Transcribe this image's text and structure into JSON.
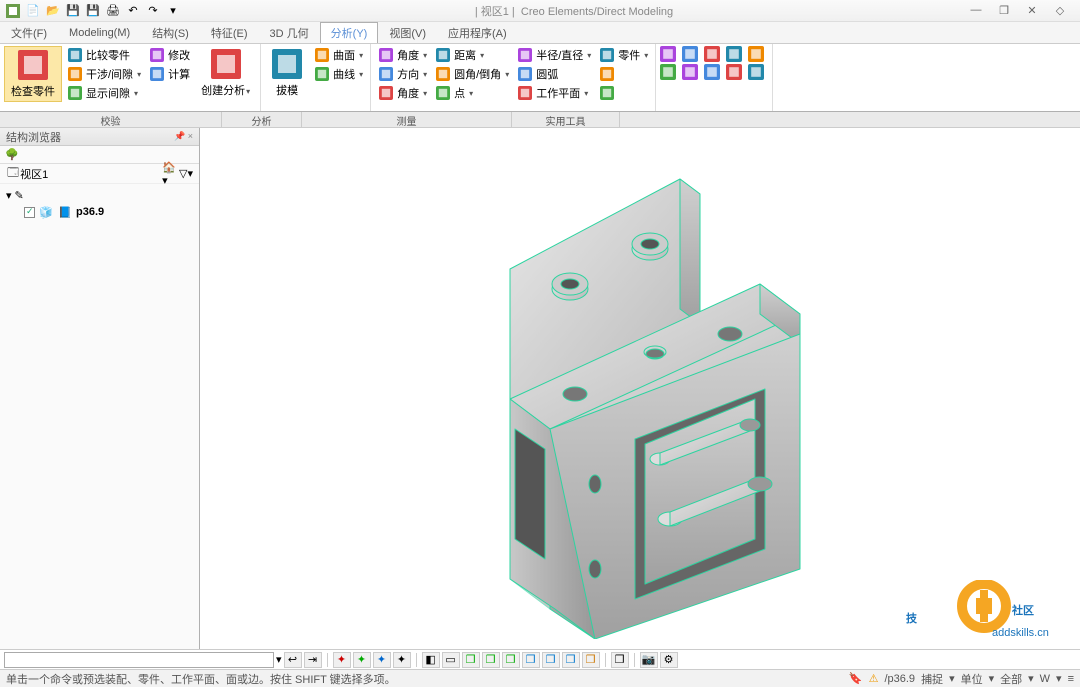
{
  "title_doc": "| 视区1 |",
  "title_app": "Creo Elements/Direct Modeling",
  "wctrl": {
    "min": "—",
    "max": "❐",
    "close": "✕",
    "help": "◇"
  },
  "tabs": [
    "文件(F)",
    "Modeling(M)",
    "结构(S)",
    "特征(E)",
    "3D 几何",
    "分析(Y)",
    "视图(V)",
    "应用程序(A)"
  ],
  "active_tab": 5,
  "ribbon": {
    "groups": [
      {
        "label": "校验",
        "big": [
          {
            "name": "检查零件",
            "active": true
          }
        ],
        "cols": [
          [
            {
              "l": "比较零件"
            },
            {
              "l": "干涉/间隙",
              "d": true
            },
            {
              "l": "显示间隙",
              "d": true
            }
          ],
          [
            {
              "l": "修改"
            },
            {
              "l": "计算"
            }
          ]
        ],
        "big2": [
          {
            "name": "创建分析",
            "d": true
          }
        ]
      },
      {
        "label": "分析",
        "big": [
          {
            "name": "拔模",
            "d": true
          }
        ],
        "cols": [
          [
            {
              "l": "曲面",
              "d": true
            },
            {
              "l": "曲线",
              "d": true
            }
          ]
        ]
      },
      {
        "label": "测量",
        "cols": [
          [
            {
              "l": "角度",
              "d": true
            },
            {
              "l": "方向",
              "d": true
            },
            {
              "l": "角度",
              "d": true
            }
          ],
          [
            {
              "l": "距离",
              "d": true
            },
            {
              "l": "圆角/倒角",
              "d": true
            },
            {
              "l": "点",
              "d": true
            }
          ],
          [
            {
              "l": "半径/直径",
              "d": true
            },
            {
              "l": "圆弧"
            },
            {
              "l": "工作平面",
              "d": true
            }
          ],
          [
            {
              "l": "零件",
              "d": true
            },
            {
              "l": ""
            },
            {
              "l": ""
            }
          ]
        ]
      },
      {
        "label": "实用工具",
        "grid": true
      }
    ]
  },
  "group_widths": [
    222,
    80,
    210,
    108
  ],
  "sidebar": {
    "title": "结构浏览器",
    "pin": "📌 ×",
    "viewport": "视区1",
    "tree": [
      {
        "name": "p36.9"
      }
    ]
  },
  "cmdbar": {
    "placeholder": ""
  },
  "status": {
    "hint": "单击一个命令或预选装配、零件、工作平面、面或边。按住 SHIFT 键选择多项。",
    "path": "/p36.9",
    "snap": "捕捉",
    "unit": "单位",
    "all": "全部",
    "wp": "W"
  },
  "watermark": {
    "t1": "技",
    "t2": "社区",
    "t3": "addskills.cn"
  }
}
